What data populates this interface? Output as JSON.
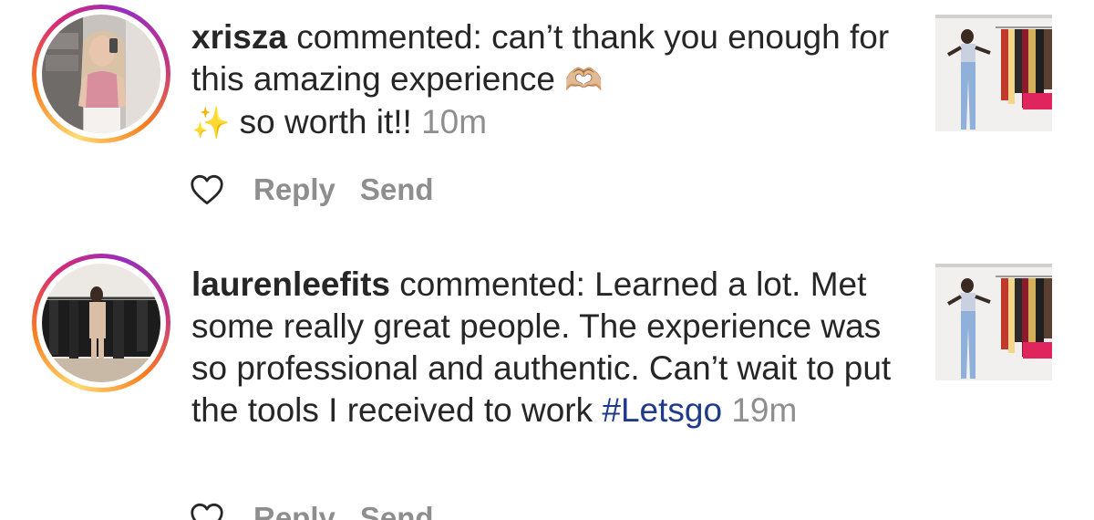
{
  "comments": [
    {
      "username": "xrisza",
      "verb": "commented:",
      "text": "can’t thank you enough for this amazing experience",
      "emoji_heart_hands": "🫶🏼",
      "emoji_sparkles": "✨",
      "text_after_emoji": "so worth it!!",
      "hashtag": "",
      "timestamp": "10m",
      "actions": {
        "reply": "Reply",
        "send": "Send"
      },
      "icons": {
        "like": "heart-outline-icon"
      }
    },
    {
      "username": "laurenleefits",
      "verb": "commented:",
      "text": "Learned a lot. Met some really great people. The experience was so professional and authentic.  Can’t wait to put the tools I received to work",
      "hashtag": "#Letsgo",
      "timestamp": "19m",
      "actions": {
        "reply": "Reply",
        "send": "Send"
      },
      "icons": {
        "like": "heart-outline-icon"
      }
    }
  ],
  "colors": {
    "text": "#262626",
    "muted": "#8e8e8e",
    "hashtag": "#1e3a8a",
    "story_ring": [
      "#feda75",
      "#fa7e1e",
      "#d62976",
      "#962fbf"
    ]
  }
}
